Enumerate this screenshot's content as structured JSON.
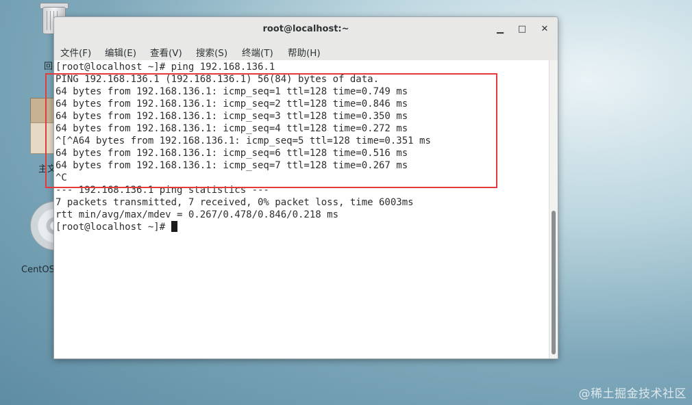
{
  "desktop": {
    "trash_label": "回",
    "home_label": "主文",
    "dvd_label": "CentOS",
    "watermark": "@稀土掘金技术社区"
  },
  "window": {
    "title": "root@localhost:~",
    "controls": {
      "minimize": "▁",
      "maximize": "□",
      "close": "✕"
    }
  },
  "menu": [
    "文件(F)",
    "编辑(E)",
    "查看(V)",
    "搜索(S)",
    "终端(T)",
    "帮助(H)"
  ],
  "terminal_lines": [
    "[root@localhost ~]# ping 192.168.136.1",
    "PING 192.168.136.1 (192.168.136.1) 56(84) bytes of data.",
    "64 bytes from 192.168.136.1: icmp_seq=1 ttl=128 time=0.749 ms",
    "64 bytes from 192.168.136.1: icmp_seq=2 ttl=128 time=0.846 ms",
    "64 bytes from 192.168.136.1: icmp_seq=3 ttl=128 time=0.350 ms",
    "64 bytes from 192.168.136.1: icmp_seq=4 ttl=128 time=0.272 ms",
    "^[^A64 bytes from 192.168.136.1: icmp_seq=5 ttl=128 time=0.351 ms",
    "64 bytes from 192.168.136.1: icmp_seq=6 ttl=128 time=0.516 ms",
    "64 bytes from 192.168.136.1: icmp_seq=7 ttl=128 time=0.267 ms",
    "^C",
    "--- 192.168.136.1 ping statistics ---",
    "7 packets transmitted, 7 received, 0% packet loss, time 6003ms",
    "rtt min/avg/max/mdev = 0.267/0.478/0.846/0.218 ms",
    "[root@localhost ~]# "
  ],
  "colors": {
    "highlight": "#e23b3b"
  }
}
